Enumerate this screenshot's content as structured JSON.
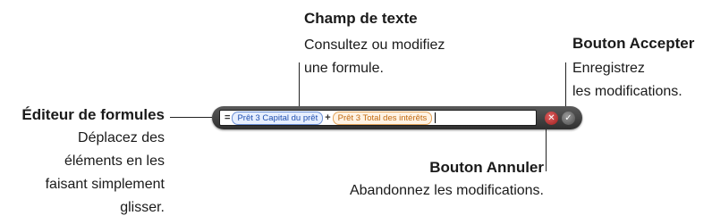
{
  "formula_editor": {
    "leading_operator": "=",
    "tokens": [
      {
        "label": "Prêt 3 Capital du prêt",
        "color": "#1f4fb0"
      },
      {
        "label": "Prêt 3 Total des intérêts",
        "color": "#c26a10"
      }
    ],
    "joining_operator": "+",
    "cancel_icon": "x-icon",
    "accept_icon": "checkmark-icon"
  },
  "callouts": {
    "text_field": {
      "title": "Champ de texte",
      "line1": "Consultez ou modifiez",
      "line2": "une formule."
    },
    "accept_button": {
      "title": "Bouton Accepter",
      "line1": "Enregistrez",
      "line2": "les modifications."
    },
    "formula_editor": {
      "title": "Éditeur de formules",
      "line1": "Déplacez des",
      "line2": "éléments en les",
      "line3": "faisant simplement",
      "line4": "glisser."
    },
    "cancel_button": {
      "title": "Bouton Annuler",
      "line1": "Abandonnez les modifications."
    }
  }
}
